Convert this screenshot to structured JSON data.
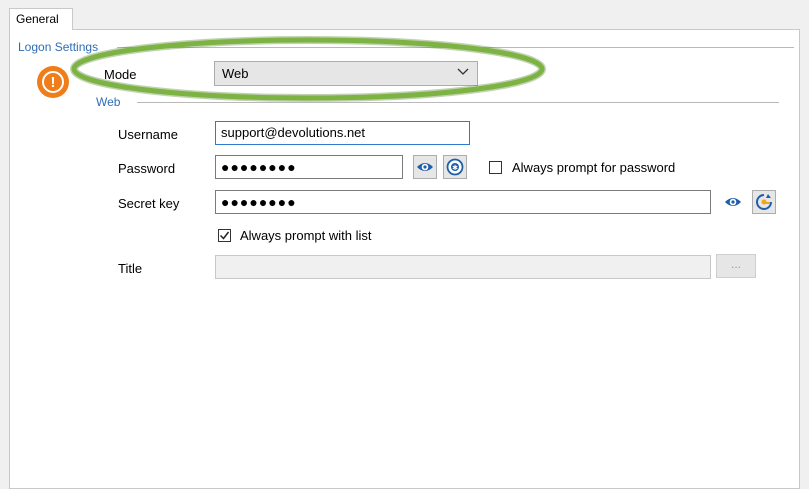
{
  "tabs": [
    {
      "label": "General"
    }
  ],
  "logon_settings": {
    "group_title": "Logon Settings",
    "mode_label": "Mode",
    "mode_value": "Web"
  },
  "web": {
    "group_title": "Web",
    "username_label": "Username",
    "username_value": "support@devolutions.net",
    "password_label": "Password",
    "password_value": "●●●●●●●●",
    "always_prompt_password_label": "Always prompt for password",
    "always_prompt_password_checked": false,
    "secret_key_label": "Secret key",
    "secret_key_value": "●●●●●●●●",
    "always_prompt_list_label": "Always prompt with list",
    "always_prompt_list_checked": true,
    "title_label": "Title",
    "title_value": "",
    "ellipsis_label": "..."
  },
  "colors": {
    "highlight": "#7cb342",
    "warning": "#ef7d1a",
    "group_title": "#2f6db5",
    "eye_icon": "#1f5fa8"
  },
  "icons": [
    "warning-icon",
    "chevron-down-icon",
    "eye-icon",
    "password-generator-icon",
    "key-refresh-icon",
    "checkmark-icon"
  ]
}
